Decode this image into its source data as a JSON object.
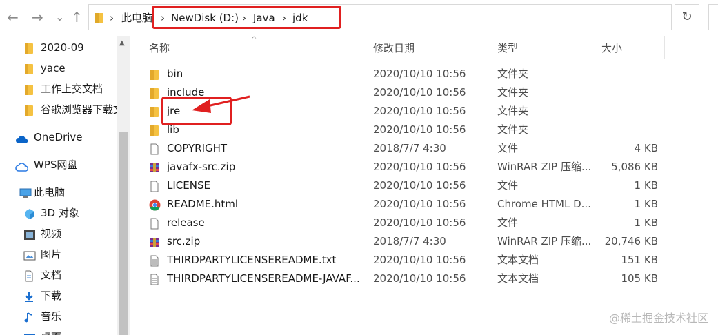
{
  "nav": {
    "back": "←",
    "forward": "→",
    "recent": "⌄",
    "up": "↑"
  },
  "address": {
    "root": "此电脑",
    "parts": [
      "NewDisk (D:)",
      "Java",
      "jdk"
    ],
    "separator": "›",
    "dropdown": "⌄",
    "refresh": "↻"
  },
  "sidebar": {
    "items": [
      {
        "label": "2020-09",
        "icon": "folder-icon"
      },
      {
        "label": "yace",
        "icon": "folder-icon"
      },
      {
        "label": "工作上交文档",
        "icon": "folder-icon"
      },
      {
        "label": "谷歌浏览器下载文",
        "icon": "folder-icon"
      },
      {
        "label": "OneDrive",
        "icon": "cloud-icon"
      },
      {
        "label": "WPS网盘",
        "icon": "wps-cloud-icon"
      },
      {
        "label": "此电脑",
        "icon": "computer-icon"
      },
      {
        "label": "3D 对象",
        "icon": "3d-objects-icon"
      },
      {
        "label": "视频",
        "icon": "video-icon"
      },
      {
        "label": "图片",
        "icon": "pictures-icon"
      },
      {
        "label": "文档",
        "icon": "documents-icon"
      },
      {
        "label": "下载",
        "icon": "download-icon"
      },
      {
        "label": "音乐",
        "icon": "music-icon"
      },
      {
        "label": "桌面",
        "icon": "desktop-icon"
      }
    ]
  },
  "columns": {
    "name": "名称",
    "date": "修改日期",
    "type": "类型",
    "size": "大小",
    "sort_indicator": "^"
  },
  "files": [
    {
      "name": "bin",
      "date": "2020/10/10 10:56",
      "type": "文件夹",
      "size": "",
      "icon": "folder"
    },
    {
      "name": "include",
      "date": "2020/10/10 10:56",
      "type": "文件夹",
      "size": "",
      "icon": "folder"
    },
    {
      "name": "jre",
      "date": "2020/10/10 10:56",
      "type": "文件夹",
      "size": "",
      "icon": "folder"
    },
    {
      "name": "lib",
      "date": "2020/10/10 10:56",
      "type": "文件夹",
      "size": "",
      "icon": "folder"
    },
    {
      "name": "COPYRIGHT",
      "date": "2018/7/7 4:30",
      "type": "文件",
      "size": "4 KB",
      "icon": "file"
    },
    {
      "name": "javafx-src.zip",
      "date": "2020/10/10 10:56",
      "type": "WinRAR ZIP 压缩...",
      "size": "5,086 KB",
      "icon": "zip"
    },
    {
      "name": "LICENSE",
      "date": "2020/10/10 10:56",
      "type": "文件",
      "size": "1 KB",
      "icon": "file"
    },
    {
      "name": "README.html",
      "date": "2020/10/10 10:56",
      "type": "Chrome HTML D...",
      "size": "1 KB",
      "icon": "chrome"
    },
    {
      "name": "release",
      "date": "2020/10/10 10:56",
      "type": "文件",
      "size": "1 KB",
      "icon": "file"
    },
    {
      "name": "src.zip",
      "date": "2018/7/7 4:30",
      "type": "WinRAR ZIP 压缩...",
      "size": "20,746 KB",
      "icon": "zip"
    },
    {
      "name": "THIRDPARTYLICENSEREADME.txt",
      "date": "2020/10/10 10:56",
      "type": "文本文档",
      "size": "151 KB",
      "icon": "text"
    },
    {
      "name": "THIRDPARTYLICENSEREADME-JAVAF...",
      "date": "2020/10/10 10:56",
      "type": "文本文档",
      "size": "105 KB",
      "icon": "text"
    }
  ],
  "watermark": "@稀土掘金技术社区",
  "colors": {
    "annotation": "#e02020",
    "folder": "#f5c242",
    "accent": "#0078d4"
  }
}
